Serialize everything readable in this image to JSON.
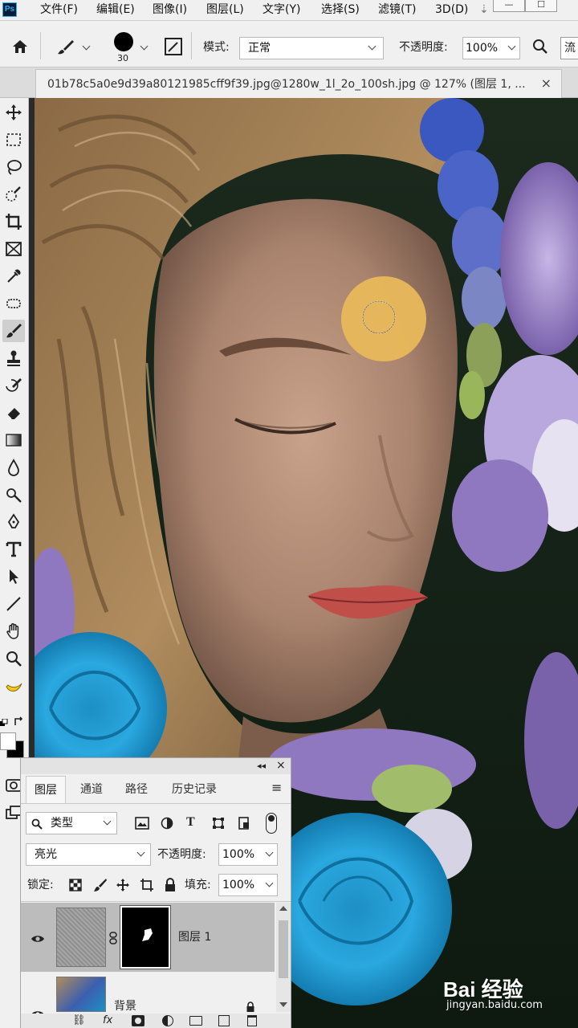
{
  "app": {
    "logo": "Ps",
    "accent": "#31a8ff"
  },
  "menubar": {
    "items": [
      "文件(F)",
      "编辑(E)",
      "图像(I)",
      "图层(L)",
      "文字(Y)",
      "选择(S)",
      "滤镜(T)",
      "3D(D)",
      "⇣"
    ],
    "window_buttons": [
      "—",
      "☐"
    ]
  },
  "options": {
    "brush_size": "30",
    "mode_label": "模式:",
    "mode_value": "正常",
    "opacity_label": "不透明度:",
    "opacity_value": "100%",
    "overflow_text": "流"
  },
  "document": {
    "tab_title": "01b78c5a0e9d39a80121985cff9f39.jpg@1280w_1l_2o_100sh.jpg @ 127% (图层 1, ...",
    "close": "×"
  },
  "toolbar": {
    "icons": [
      "move-icon",
      "marquee-icon",
      "lasso-icon",
      "quick-select-icon",
      "crop-icon",
      "frame-icon",
      "eyedropper-icon",
      "healing-icon",
      "brush-icon",
      "stamp-icon",
      "history-brush-icon",
      "eraser-icon",
      "gradient-icon",
      "blur-icon",
      "dodge-icon",
      "pen-icon",
      "type-icon",
      "path-select-icon",
      "line-icon",
      "hand-icon",
      "zoom-icon",
      "banana-icon"
    ],
    "active": "brush-icon"
  },
  "layers_panel": {
    "collapse": "◂◂",
    "close": "×",
    "tabs": [
      "图层",
      "通道",
      "路径",
      "历史记录"
    ],
    "menu": "≡",
    "filter_label": "类型",
    "blend_mode": "亮光",
    "opacity_label": "不透明度:",
    "opacity_value": "100%",
    "lock_label": "锁定:",
    "fill_label": "填充:",
    "fill_value": "100%",
    "layers": [
      {
        "name": "图层 1",
        "selected": true
      },
      {
        "name": "背景",
        "selected": false
      }
    ],
    "footer_icons": [
      "link-icon",
      "fx-icon",
      "mask-icon",
      "adjustment-icon",
      "folder-icon",
      "new-layer-icon",
      "trash-icon"
    ],
    "fx_text": "fx"
  },
  "watermark": {
    "brand": "Bai 经验",
    "url": "jingyan.baidu.com"
  },
  "colors": {
    "panel_bg": "#f0f0f0",
    "brush_spot": "#e8b85a",
    "lips": "#c9574e"
  }
}
